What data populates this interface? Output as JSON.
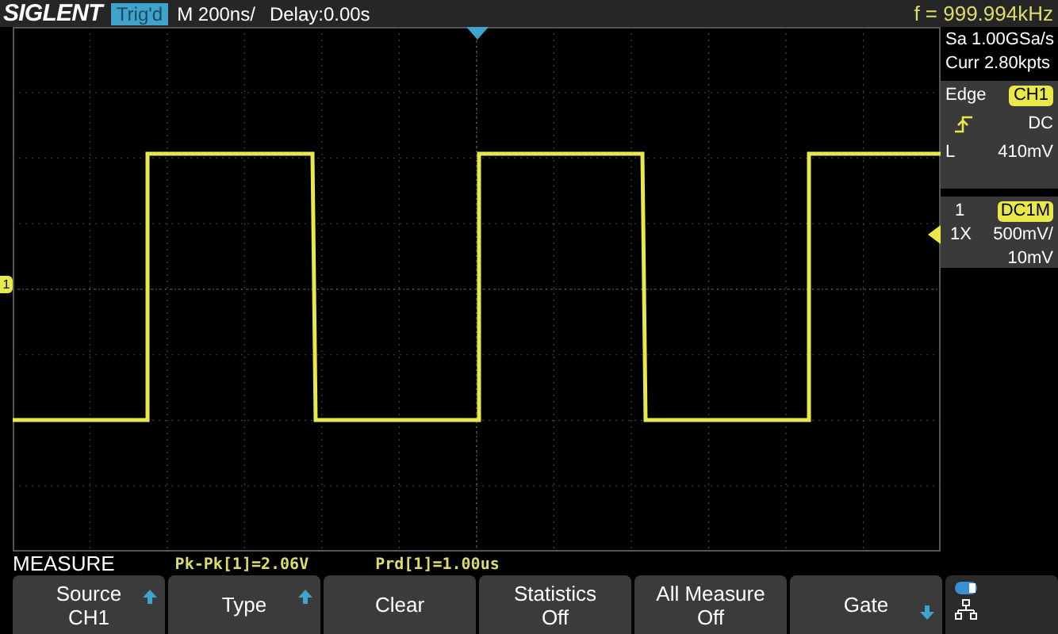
{
  "header": {
    "logo": "SIGLENT",
    "trigger_status": "Trig'd",
    "timebase": "M 200ns/",
    "delay": "Delay:0.00s",
    "frequency": "f = 999.994kHz"
  },
  "side_panel": {
    "sample_rate": "Sa 1.00GSa/s",
    "memory_depth": "Curr 2.80kpts",
    "trigger": {
      "type": "Edge",
      "source": "CH1",
      "coupling": "DC",
      "level_label": "L",
      "level_value": "410mV"
    },
    "channel": {
      "number": "1",
      "coupling": "DC1M",
      "probe": "1X",
      "scale": "500mV/",
      "offset": "10mV"
    }
  },
  "channel_marker": "1",
  "measure": {
    "title": "MEASURE",
    "readings": [
      "Pk-Pk[1]=2.06V",
      "Prd[1]=1.00us"
    ]
  },
  "softkeys": [
    {
      "label": "Source",
      "value": "CH1",
      "kind": "menu"
    },
    {
      "label": "Type",
      "kind": "menu"
    },
    {
      "label": "Clear",
      "kind": "action"
    },
    {
      "label": "Statistics",
      "value": "Off",
      "kind": "action"
    },
    {
      "label": "All Measure",
      "value": "Off",
      "kind": "action"
    },
    {
      "label": "Gate",
      "kind": "submenu"
    }
  ]
}
